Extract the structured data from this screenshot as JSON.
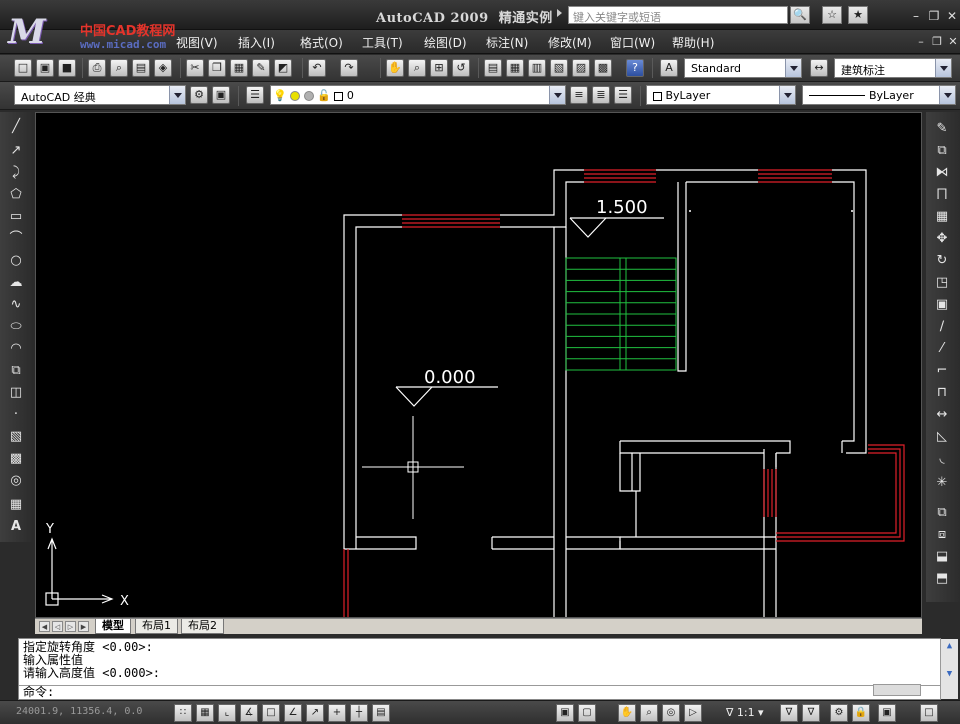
{
  "window": {
    "title": "AutoCAD 2009",
    "title_suffix": "精通实例",
    "logo_cn": "中国CAD教程网",
    "logo_url": "www.micad.com",
    "search_placeholder": "键入关键字或短语"
  },
  "menu": [
    "视图(V)",
    "插入(I)",
    "格式(O)",
    "工具(T)",
    "绘图(D)",
    "标注(N)",
    "修改(M)",
    "窗口(W)",
    "帮助(H)"
  ],
  "toolbar_std": {
    "text_style": "Standard",
    "dim_style": "建筑标注"
  },
  "toolbar_layers": {
    "workspace": "AutoCAD 经典",
    "layer": "0",
    "color": "ByLayer",
    "linetype": "ByLayer"
  },
  "drawing": {
    "elevation_upper": "1.500",
    "elevation_lower": "0.000",
    "ucs_y": "Y",
    "ucs_x": "X"
  },
  "layout_tabs": {
    "model": "模型",
    "layout1": "布局1",
    "layout2": "布局2"
  },
  "command": {
    "history": [
      "指定旋转角度 <0.00>:",
      "输入属性值",
      "请输入高度值 <0.000>:"
    ],
    "prompt": "命令:"
  },
  "status": {
    "coords": "24001.9, 11356.4, 0.0",
    "scale": "1:1"
  },
  "colors": {
    "wall": "#ffffff",
    "window": "#e0202a",
    "stair": "#20c040",
    "canvas": "#000000"
  }
}
